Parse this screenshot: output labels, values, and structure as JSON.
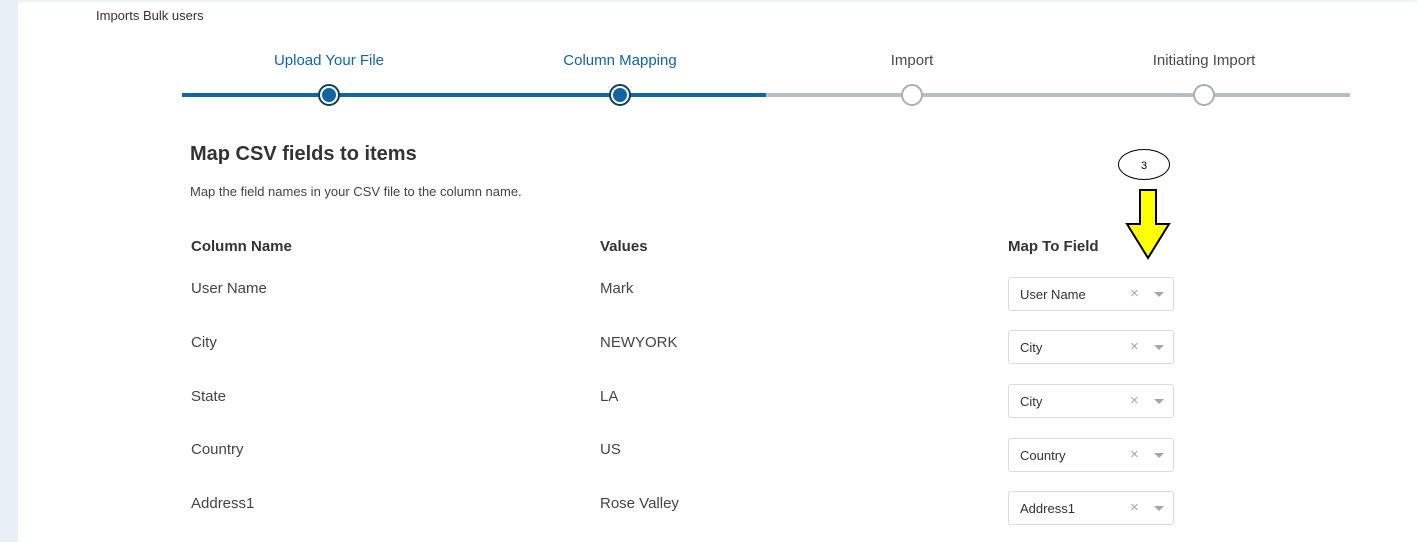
{
  "breadcrumb": "Imports Bulk users",
  "steps": [
    {
      "label": "Upload Your File",
      "state": "done"
    },
    {
      "label": "Column Mapping",
      "state": "done"
    },
    {
      "label": "Import",
      "state": "todo"
    },
    {
      "label": "Initiating Import",
      "state": "todo"
    }
  ],
  "section": {
    "title": "Map CSV fields to items",
    "subtitle": "Map the field names in your CSV file to the column name."
  },
  "table": {
    "headers": {
      "column": "Column Name",
      "values": "Values",
      "map": "Map To Field"
    },
    "rows": [
      {
        "column": "User Name",
        "value": "Mark",
        "map": "User Name"
      },
      {
        "column": "City",
        "value": "NEWYORK",
        "map": "City"
      },
      {
        "column": "State",
        "value": "LA",
        "map": "City"
      },
      {
        "column": "Country",
        "value": "US",
        "map": "Country"
      },
      {
        "column": "Address1",
        "value": "Rose Valley",
        "map": "Address1"
      }
    ]
  },
  "annotation": {
    "label": "3",
    "arrow_color": "#ffff00"
  },
  "colors": {
    "accent": "#1264a3",
    "inactive": "#b7bdc2"
  },
  "icons": {
    "clear": "clear-x-icon",
    "dropdown": "chevron-down-icon"
  }
}
